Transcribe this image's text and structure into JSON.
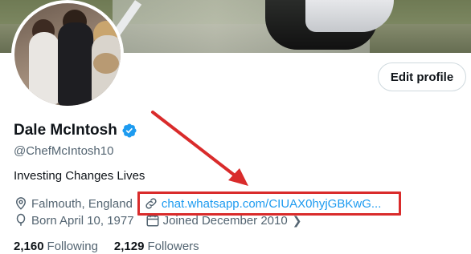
{
  "profile": {
    "name": "Dale McIntosh",
    "handle": "@ChefMcIntosh10",
    "bio": "Investing Changes Lives",
    "location": "Falmouth, England",
    "website": "chat.whatsapp.com/CIUAX0hyjGBKwG...",
    "birthday": "Born April 10, 1977",
    "joined": "Joined December 2010",
    "following_count": "2,160",
    "following_label": "Following",
    "followers_count": "2,129",
    "followers_label": "Followers"
  },
  "buttons": {
    "edit_profile": "Edit profile"
  },
  "colors": {
    "link": "#1d9bf0",
    "annotation": "#d92b2b",
    "verified": "#1d9bf0"
  },
  "icons": {
    "verified": "verified-badge-icon",
    "location": "location-pin-icon",
    "link": "link-icon",
    "birthday": "balloon-icon",
    "calendar": "calendar-icon"
  }
}
